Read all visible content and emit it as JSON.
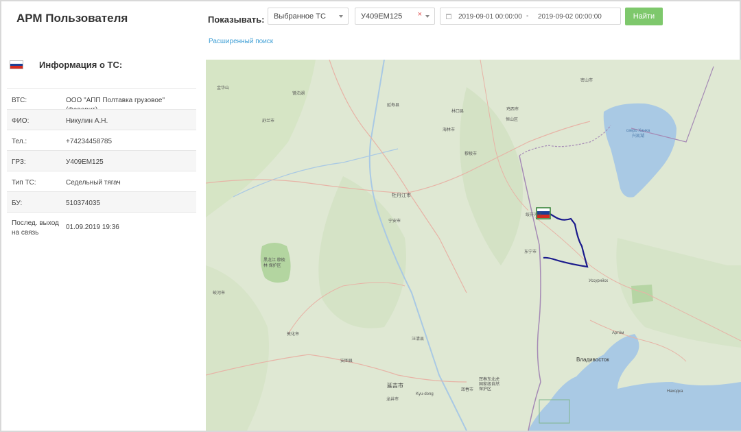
{
  "header": {
    "app_title": "АРМ Пользователя",
    "show_label": "Показывать:",
    "vehicle_filter": {
      "selected": "Выбранное ТС"
    },
    "plate_select": {
      "selected": "У409ЕМ125",
      "clear_symbol": "×"
    },
    "date_range": {
      "from": "2019-09-01 00:00:00",
      "separator": "-",
      "to": "2019-09-02 00:00:00"
    },
    "find_button": "Найти",
    "advanced_search": "Расширенный поиск"
  },
  "info_panel": {
    "title": "Информация о ТС:",
    "rows": [
      {
        "key": "ВТС:",
        "value": "ООО \"АПП Полтавка грузовое\" (Фаворит)"
      },
      {
        "key": "ФИО:",
        "value": "Никулин А.Н."
      },
      {
        "key": "Тел.:",
        "value": "+74234458785"
      },
      {
        "key": "ГРЗ:",
        "value": "У409ЕМ125"
      },
      {
        "key": "Тип ТС:",
        "value": "Седельный тягач"
      },
      {
        "key": "БУ:",
        "value": "510374035"
      },
      {
        "key": "Послед. выход на связь",
        "value": "01.09.2019 19:36"
      }
    ]
  },
  "map": {
    "labels": {
      "mudanjiang": "牡丹江市",
      "jixi": "鸡西市",
      "hengshan": "恒山区",
      "linkou": "林口县",
      "ningan": "宁安市",
      "muling": "穆棱市",
      "dongning": "东宁市",
      "suifenhe": "绥芬河市",
      "dunhua": "敦化市",
      "wangqing": "汪清县",
      "antu": "安图县",
      "yanji": "延吉市",
      "longjing": "龙井市",
      "huichun": "珲春市",
      "hailin": "海林市",
      "jingbohu": "镜泊湖",
      "heilongjiang_reserve": "黑龙江 穆棱林 保护区",
      "jiaohe": "蛟河市",
      "shulan": "舒兰市",
      "jinhua": "金华山",
      "yilan": "延寿县",
      "mishan": "密山市",
      "khanka": "озеро Ханка 兴凯湖",
      "ussuriysk": "Уссурийск",
      "artem": "Артём",
      "vladivostok": "Владивосток",
      "nakhodka": "Находка",
      "kyudong": "Kyu-dong",
      "hunchun_reserve": "珲春东北虎 国家级自然 保护区"
    }
  },
  "colors": {
    "accent_green": "#7ec86c",
    "link_blue": "#3f9fd5",
    "track_blue": "#1a1a8c",
    "flag_white": "#ffffff",
    "flag_blue": "#1c3f94",
    "flag_red": "#d52b1e"
  },
  "icons": {
    "flag": "russian-flag-icon",
    "calendar": "calendar-icon",
    "caret": "chevron-down-icon",
    "clear": "close-icon"
  }
}
